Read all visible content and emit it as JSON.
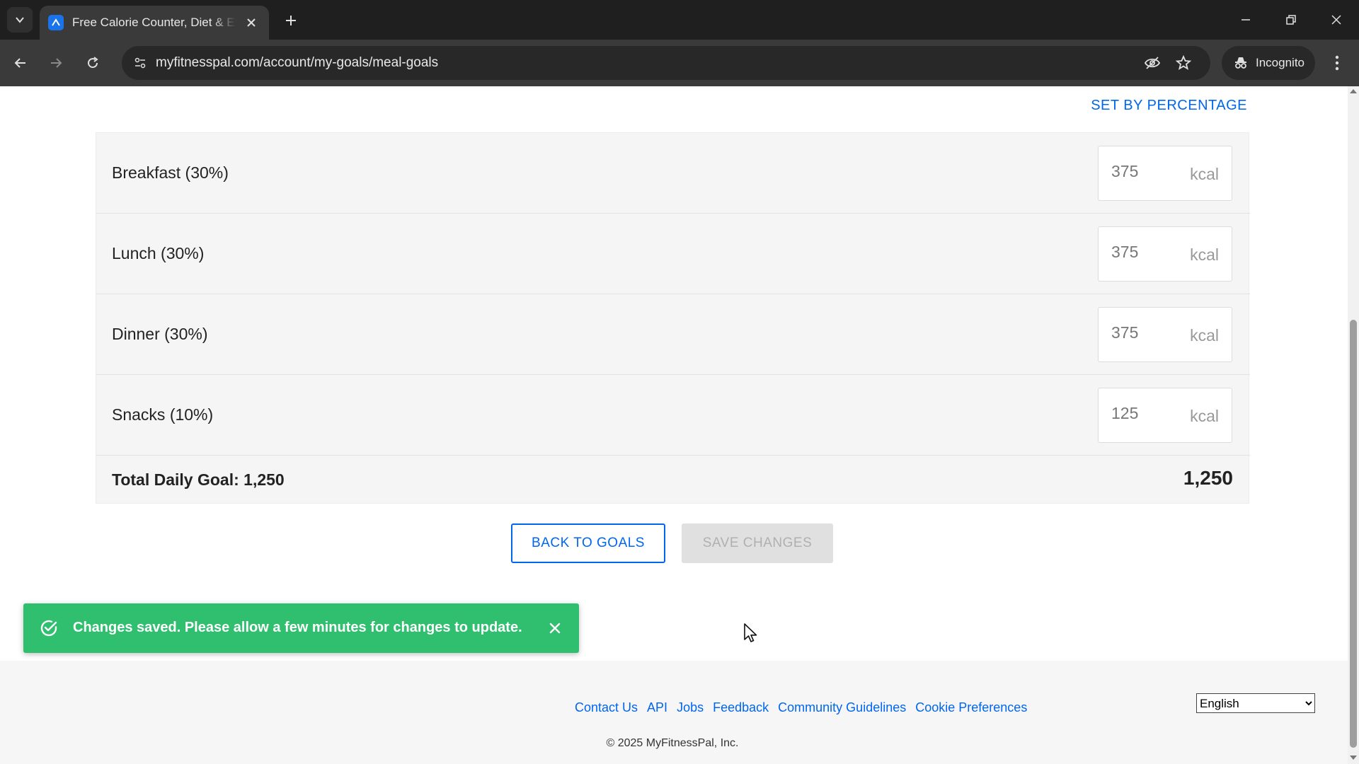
{
  "browser": {
    "tab_title": "Free Calorie Counter, Diet & Exercise Journal",
    "url": "myfitnesspal.com/account/my-goals/meal-goals",
    "incognito_label": "Incognito"
  },
  "page": {
    "set_by_percentage": "SET BY PERCENTAGE",
    "unit": "kcal",
    "meals": [
      {
        "label": "Breakfast (30%)",
        "value": "375"
      },
      {
        "label": "Lunch (30%)",
        "value": "375"
      },
      {
        "label": "Dinner (30%)",
        "value": "375"
      },
      {
        "label": "Snacks (10%)",
        "value": "125"
      }
    ],
    "total_label": "Total Daily Goal: 1,250",
    "total_value": "1,250",
    "back_button": "BACK TO GOALS",
    "save_button": "SAVE CHANGES"
  },
  "footer": {
    "links": [
      "Contact Us",
      "API",
      "Jobs",
      "Feedback",
      "Community Guidelines",
      "Cookie Preferences"
    ],
    "copyright": "© 2025 MyFitnessPal, Inc.",
    "language": "English"
  },
  "toast": {
    "message": "Changes saved. Please allow a few minutes for changes to update."
  },
  "colors": {
    "accent": "#0066ee",
    "toast": "#2fbf6f"
  }
}
